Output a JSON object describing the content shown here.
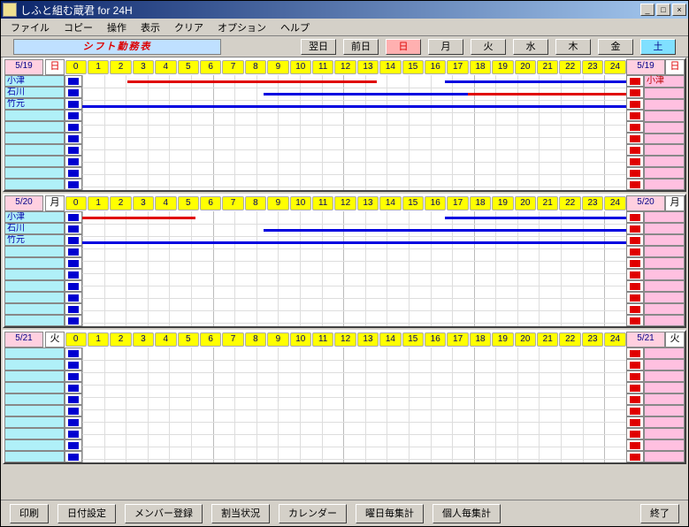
{
  "window": {
    "title": "しふと組む蔵君 for 24H"
  },
  "menu": [
    "ファイル",
    "コピー",
    "操作",
    "表示",
    "クリア",
    "オプション",
    "ヘルプ"
  ],
  "toolbar": {
    "shift_label": "シフト勤務表",
    "days": [
      {
        "label": "翌日",
        "cls": ""
      },
      {
        "label": "前日",
        "cls": ""
      },
      {
        "label": "日",
        "cls": "red"
      },
      {
        "label": "月",
        "cls": ""
      },
      {
        "label": "火",
        "cls": ""
      },
      {
        "label": "水",
        "cls": ""
      },
      {
        "label": "木",
        "cls": ""
      },
      {
        "label": "金",
        "cls": ""
      },
      {
        "label": "土",
        "cls": "cyan"
      }
    ]
  },
  "hours": [
    "0",
    "1",
    "2",
    "3",
    "4",
    "5",
    "6",
    "7",
    "8",
    "9",
    "10",
    "11",
    "12",
    "13",
    "14",
    "15",
    "16",
    "17",
    "18",
    "19",
    "20",
    "21",
    "22",
    "23",
    "24"
  ],
  "panels": [
    {
      "date": "5/19",
      "dow": "日",
      "dow_cls": "dow-sun",
      "names": [
        "小津",
        "石川",
        "竹元",
        "",
        "",
        "",
        "",
        "",
        "",
        ""
      ],
      "names_r": [
        "小津",
        "",
        "",
        "",
        "",
        "",
        "",
        "",
        "",
        ""
      ],
      "bars": [
        {
          "row": 0,
          "start": 2,
          "end": 13,
          "color": "red"
        },
        {
          "row": 0,
          "start": 16,
          "end": 24,
          "color": "blue"
        },
        {
          "row": 1,
          "start": 8,
          "end": 17,
          "color": "blue"
        },
        {
          "row": 1,
          "start": 17,
          "end": 24,
          "color": "red"
        },
        {
          "row": 2,
          "start": 0,
          "end": 24,
          "color": "blue"
        }
      ]
    },
    {
      "date": "5/20",
      "dow": "月",
      "dow_cls": "dow-mon",
      "names": [
        "小津",
        "石川",
        "竹元",
        "",
        "",
        "",
        "",
        "",
        "",
        ""
      ],
      "names_r": [
        "",
        "",
        "",
        "",
        "",
        "",
        "",
        "",
        "",
        ""
      ],
      "bars": [
        {
          "row": 0,
          "start": 0,
          "end": 5,
          "color": "red"
        },
        {
          "row": 0,
          "start": 16,
          "end": 24,
          "color": "blue"
        },
        {
          "row": 1,
          "start": 8,
          "end": 24,
          "color": "blue"
        },
        {
          "row": 2,
          "start": 0,
          "end": 24,
          "color": "blue"
        }
      ]
    },
    {
      "date": "5/21",
      "dow": "火",
      "dow_cls": "dow-mon",
      "names": [
        "",
        "",
        "",
        "",
        "",
        "",
        "",
        "",
        "",
        ""
      ],
      "names_r": [
        "",
        "",
        "",
        "",
        "",
        "",
        "",
        "",
        "",
        ""
      ],
      "bars": []
    }
  ],
  "bottom": {
    "print": "印刷",
    "date_set": "日付設定",
    "member_reg": "メンバー登録",
    "alloc": "割当状況",
    "calendar": "カレンダー",
    "dow_total": "曜日毎集計",
    "person_total": "個人毎集計",
    "exit": "終了"
  },
  "chart_data": {
    "type": "gantt",
    "x_unit": "hour",
    "x_range": [
      0,
      24
    ],
    "days": [
      {
        "date": "5/19",
        "weekday": "日",
        "employees": [
          {
            "name": "小津",
            "shifts": [
              [
                2,
                13,
                "red"
              ],
              [
                16,
                24,
                "blue"
              ]
            ]
          },
          {
            "name": "石川",
            "shifts": [
              [
                8,
                17,
                "blue"
              ],
              [
                17,
                24,
                "red"
              ]
            ]
          },
          {
            "name": "竹元",
            "shifts": [
              [
                0,
                24,
                "blue"
              ]
            ]
          }
        ]
      },
      {
        "date": "5/20",
        "weekday": "月",
        "employees": [
          {
            "name": "小津",
            "shifts": [
              [
                0,
                5,
                "red"
              ],
              [
                16,
                24,
                "blue"
              ]
            ]
          },
          {
            "name": "石川",
            "shifts": [
              [
                8,
                24,
                "blue"
              ]
            ]
          },
          {
            "name": "竹元",
            "shifts": [
              [
                0,
                24,
                "blue"
              ]
            ]
          }
        ]
      },
      {
        "date": "5/21",
        "weekday": "火",
        "employees": []
      }
    ]
  }
}
